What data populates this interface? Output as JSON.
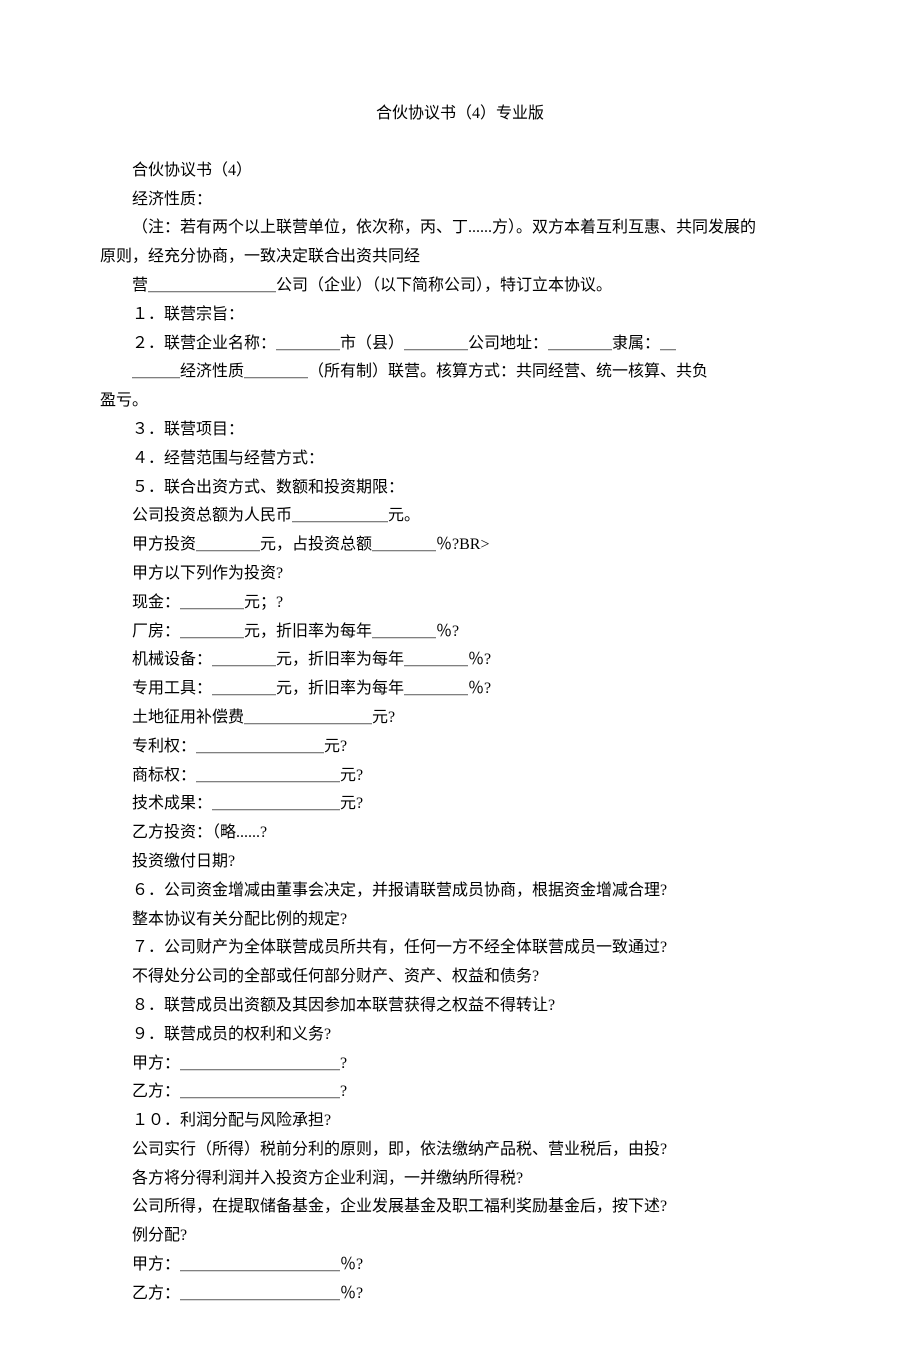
{
  "title": "合伙协议书（4）专业版",
  "lines": [
    "合伙协议书（4）",
    "经济性质：",
    "（注：若有两个以上联营单位，依次称，丙、丁......方）。双方本着互利互惠、共同发展的",
    "原则，经充分协商，一致决定联合出资共同经",
    "营＿＿＿＿＿＿＿＿公司（企业）（以下简称公司），特订立本协议。",
    "１．联营宗旨：",
    "２．联营企业名称：＿＿＿＿市（县）＿＿＿＿公司地址：＿＿＿＿隶属：＿",
    "＿＿＿经济性质＿＿＿＿（所有制）联营。核算方式：共同经营、统一核算、共负",
    "盈亏。",
    "３．联营项目：",
    "４．经营范围与经营方式：",
    "５．联合出资方式、数额和投资期限：",
    "公司投资总额为人民币＿＿＿＿＿＿元。",
    "甲方投资＿＿＿＿元，占投资总额＿＿＿＿％?BR>",
    "甲方以下列作为投资?",
    "现金：＿＿＿＿元；?",
    "厂房：＿＿＿＿元，折旧率为每年＿＿＿＿％?",
    "机械设备：＿＿＿＿元，折旧率为每年＿＿＿＿％?",
    "专用工具：＿＿＿＿元，折旧率为每年＿＿＿＿％?",
    "土地征用补偿费＿＿＿＿＿＿＿＿元?",
    "专利权：＿＿＿＿＿＿＿＿元?",
    "商标权：＿＿＿＿＿＿＿＿＿元?",
    "技术成果：＿＿＿＿＿＿＿＿元?",
    "乙方投资：（略......?",
    "投资缴付日期?",
    "６．公司资金增减由董事会决定，并报请联营成员协商，根据资金增减合理?",
    "整本协议有关分配比例的规定?",
    "７．公司财产为全体联营成员所共有，任何一方不经全体联营成员一致通过?",
    "不得处分公司的全部或任何部分财产、资产、权益和债务?",
    "８．联营成员出资额及其因参加本联营获得之权益不得转让?",
    "９．联营成员的权利和义务?",
    "甲方：＿＿＿＿＿＿＿＿＿＿?",
    "乙方：＿＿＿＿＿＿＿＿＿＿?",
    "１０．利润分配与风险承担?",
    "公司实行（所得）税前分利的原则，即，依法缴纳产品税、营业税后，由投?",
    "各方将分得利润并入投资方企业利润，一并缴纳所得税?",
    "公司所得，在提取储备基金，企业发展基金及职工福利奖励基金后，按下述?",
    "例分配?",
    "甲方：＿＿＿＿＿＿＿＿＿＿％?",
    "乙方：＿＿＿＿＿＿＿＿＿＿％?"
  ],
  "noindent_indexes": [
    3,
    8
  ]
}
